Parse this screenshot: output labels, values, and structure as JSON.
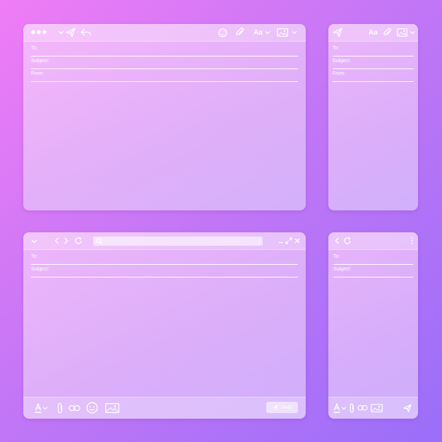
{
  "compose_desktop": {
    "toolbar": {
      "font_label": "Aa"
    },
    "fields": [
      {
        "label": "To:"
      },
      {
        "label": "Subject:"
      },
      {
        "label": "From:"
      }
    ]
  },
  "compose_mobile": {
    "toolbar": {
      "font_label": "Aa"
    },
    "fields": [
      {
        "label": "To:"
      },
      {
        "label": "Subject:"
      },
      {
        "label": "From:"
      }
    ]
  },
  "browser_desktop": {
    "search": {
      "placeholder": ""
    },
    "fields": [
      {
        "label": "To:"
      },
      {
        "label": "Subject:"
      }
    ],
    "footer": {
      "send_label": "Send"
    }
  },
  "browser_mobile": {
    "fields": [
      {
        "label": "To:"
      },
      {
        "label": "Subject:"
      }
    ]
  },
  "colors": {
    "background_start": "#f07cf6",
    "background_end": "#9b6ef9",
    "foreground": "#ffffff"
  }
}
